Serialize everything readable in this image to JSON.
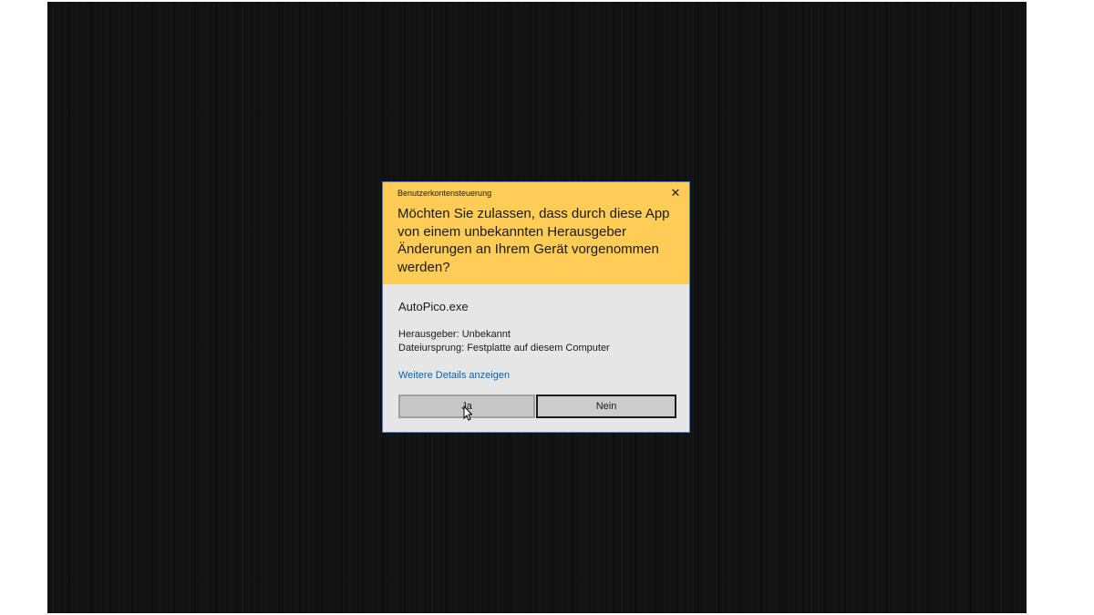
{
  "dialog": {
    "window_title": "Benutzerkontensteuerung",
    "close_glyph": "✕",
    "question": "Möchten Sie zulassen, dass durch diese App von einem unbekannten Herausgeber Änderungen an Ihrem Gerät vorgenommen werden?",
    "app_name": "AutoPico.exe",
    "publisher": "Herausgeber: Unbekannt",
    "origin": "Dateiursprung: Festplatte auf diesem Computer",
    "details_link": "Weitere Details anzeigen",
    "yes_label": "Ja",
    "no_label": "Nein"
  },
  "colors": {
    "header_background": "#ffcd55",
    "body_background": "#e6e6e6",
    "border": "#3d7fcf",
    "link": "#0063b1",
    "desktop": "#121212"
  },
  "icons": {
    "close": "close-icon",
    "cursor": "mouse-pointer-icon"
  }
}
